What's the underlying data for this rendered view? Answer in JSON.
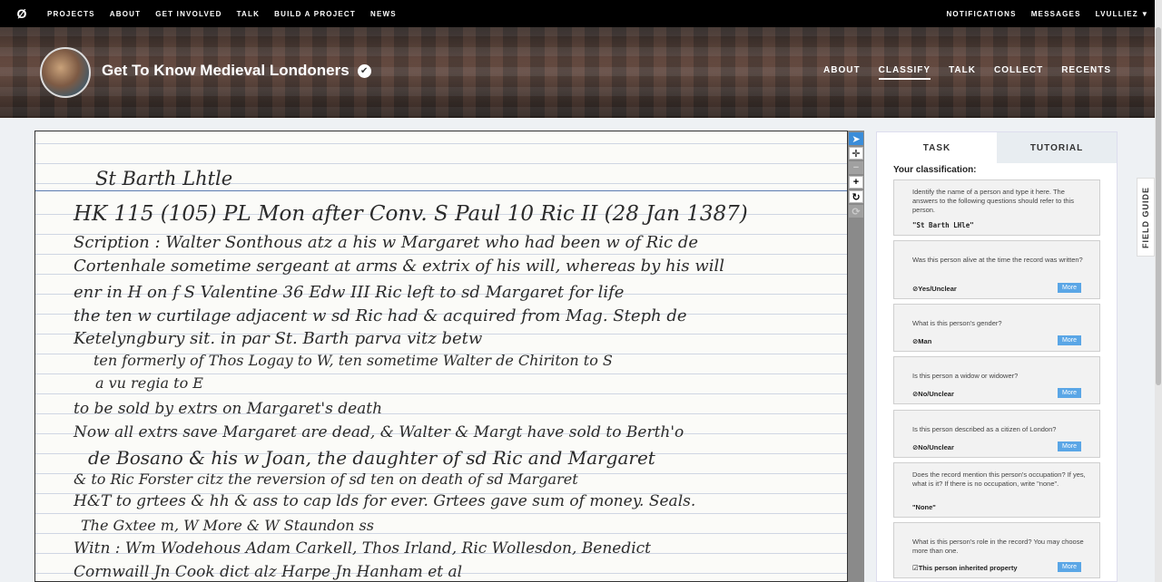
{
  "topnav": {
    "logo": "Ø",
    "links": [
      "PROJECTS",
      "ABOUT",
      "GET INVOLVED",
      "TALK",
      "BUILD A PROJECT",
      "NEWS"
    ],
    "right": [
      "NOTIFICATIONS",
      "MESSAGES",
      "LVULLIEZ"
    ]
  },
  "project": {
    "title": "Get To Know Medieval Londoners",
    "nav": [
      "ABOUT",
      "CLASSIFY",
      "TALK",
      "COLLECT",
      "RECENTS"
    ]
  },
  "subject": {
    "lines": [
      "St Barth Lhtle",
      "HK 115 (105)      PL   Mon after Conv. S Paul   10 Ric II (28 Jan 1387)",
      "Scription :   Walter Sonthous atz a his w Margaret who had been w of Ric de",
      "Cortenhale sometime sergeant at arms  & extrix of his will, whereas by his will",
      "enr  in H  on f S Valentine 36 Edw III  Ric left to sd Margaret for life",
      "the ten  w curtilage adjacent  w sd Ric had & acquired from Mag. Steph de",
      "Ketelyngbury sit. in   par St. Barth parva   vitz betw",
      "ten formerly of  Thos Logay to W, ten sometime Walter de Chiriton to S",
      "a vu regia to E",
      "to be sold by extrs on Margaret's death",
      "Now all extrs save Margaret are dead,  &  Walter & Margt have sold to Berth'o",
      "de Bosano & his w Joan, the daughter of sd Ric and Margaret",
      "& to Ric Forster citz  the reversion of sd ten on death of sd Margaret",
      "H&T to grtees & hh & ass to cap lds for ever. Grtees gave sum of money. Seals.",
      "The Gxtee m,  W More & W Staundon ss",
      "Witn :  Wm Wodehous  Adam Carkell,  Thos Irland,  Ric Wollesdon, Benedict",
      "Cornwaill   Jn Cook  dict  alz  Harpe   Jn Hanham  et al"
    ]
  },
  "toolbar": {
    "icons": [
      "pointer-icon",
      "move-icon",
      "minus-icon",
      "plus-icon",
      "rotate-icon",
      "reset-icon"
    ]
  },
  "panel": {
    "tabs": [
      "TASK",
      "TUTORIAL"
    ],
    "classification_label": "Your classification:",
    "more_label": "More",
    "questions": [
      {
        "text": "Identify the name of a person and type it here. The answers to the following questions should refer to this person.",
        "answer": "\"St Barth LHle\"",
        "has_more": false
      },
      {
        "text": "Was this person alive at the time the record was written?",
        "answer": "⊘Yes/Unclear",
        "has_more": true
      },
      {
        "text": "What is this person's gender?",
        "answer": "⊘Man",
        "has_more": true
      },
      {
        "text": "Is this person a widow or widower?",
        "answer": "⊘No/Unclear",
        "has_more": true
      },
      {
        "text": "Is this person described as a citizen of London?",
        "answer": "⊘No/Unclear",
        "has_more": true
      },
      {
        "text": "Does the record mention this person's occupation? If yes, what is it? If there is no occupation, write \"none\".",
        "answer": "\"None\"",
        "has_more": false
      },
      {
        "text": "What is this person's role in the record? You may choose more than one.",
        "answer": "☑This person inherited property",
        "has_more": true
      }
    ]
  },
  "fieldguide": {
    "label": "FIELD GUIDE"
  }
}
